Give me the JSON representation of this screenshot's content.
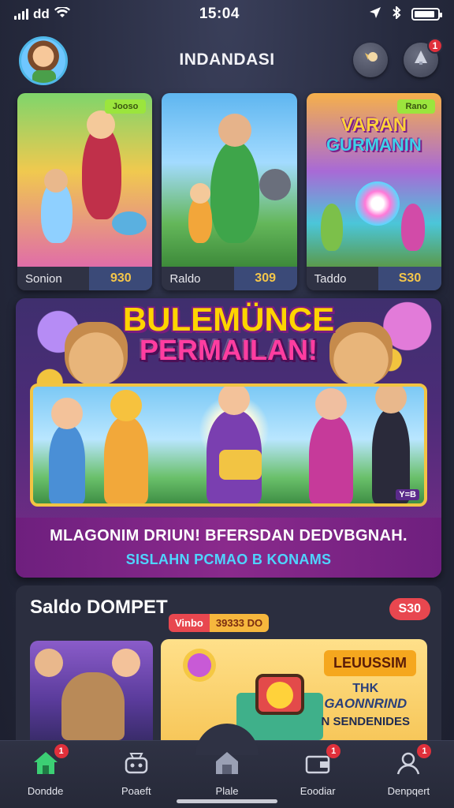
{
  "status_bar": {
    "carrier": "dd",
    "time": "15:04",
    "battery_level": 0.9
  },
  "header": {
    "title": "INDANDASI",
    "bell_icon": "coin-bell-icon",
    "notification_icon": "notification-icon",
    "notification_badge": "1"
  },
  "game_cards": [
    {
      "tag": "Jooso",
      "label": "Sonion",
      "price": "930"
    },
    {
      "tag": "",
      "label": "Raldo",
      "price": "309"
    },
    {
      "tag": "Rano",
      "logo_line1": "VARAN",
      "logo_line2": "GURMANIN",
      "label": "Taddo",
      "price": "S30"
    }
  ],
  "promo": {
    "title_line1": "BULEMÜNCE",
    "title_line2": "PERMAILAN!",
    "corner_tag": "Y=B",
    "caption_line1": "MLAGONIM DRIUN! BFERSDAN DEDVBGNAH.",
    "caption_line2": "SISLAHN PCMAO B KONAMS"
  },
  "wallet": {
    "title": "Saldo DOMPET",
    "balance_badge": "S30",
    "chip_label": "Vinbo",
    "chip_value": "39333 DO",
    "promo_headline": "LEUUSSIM",
    "promo_line1": "THK",
    "promo_line2": "GAONNRIND",
    "promo_line3": "N SENDENIDES"
  },
  "bottom_nav": [
    {
      "label": "Dondde",
      "icon": "home-icon",
      "badge": "1",
      "active": true
    },
    {
      "label": "Poaeft",
      "icon": "gamepad-icon",
      "badge": "",
      "active": false
    },
    {
      "label": "Plale",
      "icon": "store-icon",
      "badge": "",
      "active": false
    },
    {
      "label": "Eoodiar",
      "icon": "wallet-icon",
      "badge": "1",
      "active": false
    },
    {
      "label": "Denpqert",
      "icon": "profile-icon",
      "badge": "1",
      "active": false
    }
  ],
  "colors": {
    "accent_gold": "#f4c64a",
    "badge_red": "#e0303b",
    "price_bg": "#3b4a78",
    "promo_purple": "#7d2b8a",
    "active_nav": "#3ccf74"
  }
}
